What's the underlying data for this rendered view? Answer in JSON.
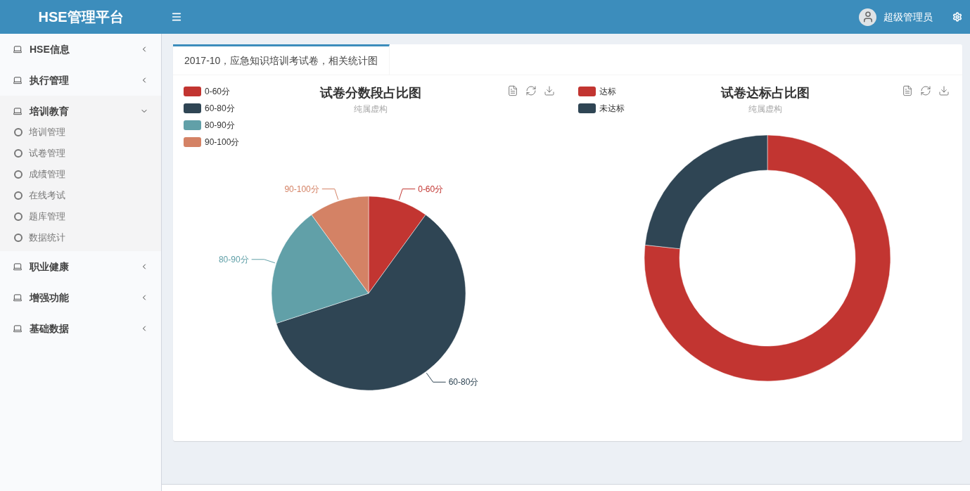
{
  "header": {
    "logo": "HSE管理平台",
    "user": "超级管理员"
  },
  "sidebar": {
    "items": [
      {
        "label": "HSE信息",
        "expanded": false
      },
      {
        "label": "执行管理",
        "expanded": false
      },
      {
        "label": "培训教育",
        "expanded": true,
        "children": [
          {
            "label": "培训管理"
          },
          {
            "label": "试卷管理"
          },
          {
            "label": "成绩管理"
          },
          {
            "label": "在线考试"
          },
          {
            "label": "题库管理"
          },
          {
            "label": "数据统计"
          }
        ]
      },
      {
        "label": "职业健康",
        "expanded": false
      },
      {
        "label": "增强功能",
        "expanded": false
      },
      {
        "label": "基础数据",
        "expanded": false
      }
    ]
  },
  "tabs": [
    {
      "label": "2017-10，应急知识培训考试卷，相关统计图",
      "selected": true
    }
  ],
  "charts": [
    {
      "subtitle": "纯属虚构",
      "legend": [
        {
          "label": "0-60分",
          "color": "#c23531"
        },
        {
          "label": "60-80分",
          "color": "#2f4554"
        },
        {
          "label": "80-90分",
          "color": "#61a0a8"
        },
        {
          "label": "90-100分",
          "color": "#d48265"
        }
      ],
      "chart_data": {
        "type": "pie",
        "title": "试卷分数段占比图",
        "categories": [
          "0-60分",
          "60-80分",
          "80-90分",
          "90-100分"
        ],
        "values": [
          10,
          60,
          20,
          10
        ]
      }
    },
    {
      "subtitle": "纯属虚构",
      "legend": [
        {
          "label": "达标",
          "color": "#c23531"
        },
        {
          "label": "未达标",
          "color": "#2f4554"
        }
      ],
      "chart_data": {
        "type": "donut",
        "title": "试卷达标占比图",
        "values": [
          76.7,
          23.3
        ]
      }
    }
  ]
}
